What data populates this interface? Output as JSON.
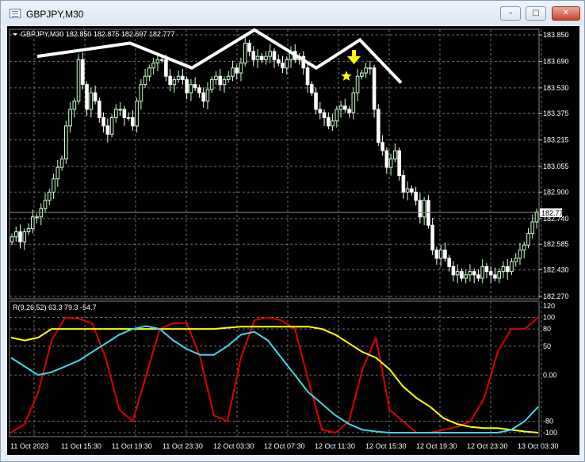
{
  "window": {
    "title": "GBPJPY,M30",
    "minimize_label": "–",
    "maximize_label": "□",
    "close_label": "✕",
    "icon": "chart-window-icon"
  },
  "main": {
    "header_text": "GBPJPY,M30  182.850 182.875 182.697 182.777",
    "current_price": "182.777",
    "current_price_value": 182.777
  },
  "colors": {
    "background": "#000000",
    "grid": "#6e6e6e",
    "bull_candle": "#ccffcc",
    "bear_candle": "#ffffff",
    "current_price_line": "#8a8a8a",
    "annotation_line": "#ffffff",
    "marker": "#ffff00",
    "ind_red": "#e00000",
    "ind_yellow": "#ffff00",
    "ind_cyan": "#40d8e8"
  },
  "indicator": {
    "header_text": "R(9,26,52) 63.3 79.3 -54.7"
  },
  "annotations": {
    "arrow_icon": "down-arrow-icon",
    "star_icon": "star-icon"
  },
  "chart_data": [
    {
      "type": "candlestick",
      "symbol": "GBPJPY",
      "timeframe": "M30",
      "ylim": [
        182.27,
        183.85
      ],
      "y_ticks": [
        "183.850",
        "183.690",
        "183.530",
        "183.375",
        "183.215",
        "183.055",
        "182.900",
        "182.740",
        "182.585",
        "182.430",
        "182.270"
      ],
      "x_labels": [
        "11 Oct 2023",
        "11 Oct 15:30",
        "11 Oct 19:30",
        "11 Oct 23:30",
        "12 Oct 03:30",
        "12 Oct 07:30",
        "12 Oct 11:30",
        "12 Oct 15:30",
        "12 Oct 19:30",
        "12 Oct 23:30",
        "13 Oct 03:30"
      ],
      "closes": [
        182.63,
        182.66,
        182.6,
        182.66,
        182.68,
        182.75,
        182.75,
        182.8,
        182.85,
        182.9,
        182.98,
        183.05,
        183.1,
        183.3,
        183.4,
        183.45,
        183.7,
        183.55,
        183.4,
        183.5,
        183.45,
        183.35,
        183.3,
        183.25,
        183.35,
        183.4,
        183.4,
        183.35,
        183.35,
        183.3,
        183.45,
        183.55,
        183.6,
        183.65,
        183.68,
        183.7,
        183.7,
        183.6,
        183.55,
        183.58,
        183.6,
        183.58,
        183.5,
        183.55,
        183.53,
        183.5,
        183.45,
        183.52,
        183.58,
        183.6,
        183.55,
        183.58,
        183.6,
        183.65,
        183.62,
        183.68,
        183.8,
        183.75,
        183.7,
        183.72,
        183.7,
        183.72,
        183.75,
        183.7,
        183.68,
        183.65,
        183.7,
        183.75,
        183.7,
        183.72,
        183.65,
        183.55,
        183.5,
        183.4,
        183.38,
        183.35,
        183.3,
        183.33,
        183.4,
        183.42,
        183.4,
        183.38,
        183.5,
        183.6,
        183.62,
        183.65,
        183.65,
        183.4,
        183.2,
        183.15,
        183.05,
        183.1,
        183.15,
        183.0,
        182.9,
        182.92,
        182.9,
        182.85,
        182.75,
        182.85,
        182.7,
        182.55,
        182.5,
        182.55,
        182.5,
        182.45,
        182.4,
        182.42,
        182.38,
        182.4,
        182.42,
        182.4,
        182.38,
        182.45,
        182.42,
        182.4,
        182.38,
        182.42,
        182.45,
        182.42,
        182.48,
        182.5,
        182.55,
        182.58,
        182.65,
        182.72,
        182.78
      ],
      "annotation_polyline_prices": [
        183.72,
        183.8,
        183.65,
        183.88,
        183.65,
        183.82,
        183.56
      ],
      "star_price": 183.6
    },
    {
      "type": "line",
      "title": "R(9,26,52) 63.3 79.3 -54.7",
      "ylim": [
        -100,
        120
      ],
      "y_ticks": [
        "120",
        "100",
        "80",
        "50",
        "0.00",
        "-80",
        "-100"
      ],
      "series": [
        {
          "color": "#e00000",
          "values": [
            -100,
            -85,
            -30,
            60,
            100,
            98,
            90,
            30,
            -60,
            -80,
            0,
            80,
            90,
            90,
            30,
            -70,
            -80,
            30,
            95,
            100,
            95,
            80,
            -10,
            -95,
            -100,
            -80,
            10,
            65,
            -60,
            -80,
            -100,
            -100,
            -95,
            -90,
            -80,
            -40,
            40,
            80,
            80,
            100
          ]
        },
        {
          "color": "#ffff00",
          "values": [
            65,
            60,
            65,
            80,
            80,
            80,
            80,
            80,
            80,
            80,
            80,
            80,
            80,
            80,
            80,
            80,
            82,
            84,
            84,
            84,
            84,
            84,
            84,
            80,
            70,
            55,
            40,
            30,
            10,
            -20,
            -40,
            -55,
            -75,
            -85,
            -90,
            -92,
            -92,
            -95,
            -98,
            -100
          ]
        },
        {
          "color": "#40d8e8",
          "values": [
            30,
            15,
            0,
            5,
            15,
            25,
            40,
            55,
            70,
            80,
            85,
            80,
            60,
            45,
            35,
            35,
            50,
            70,
            75,
            60,
            30,
            0,
            -30,
            -50,
            -70,
            -85,
            -95,
            -98,
            -100,
            -100,
            -100,
            -100,
            -100,
            -100,
            -100,
            -100,
            -100,
            -95,
            -80,
            -55
          ]
        }
      ]
    }
  ]
}
